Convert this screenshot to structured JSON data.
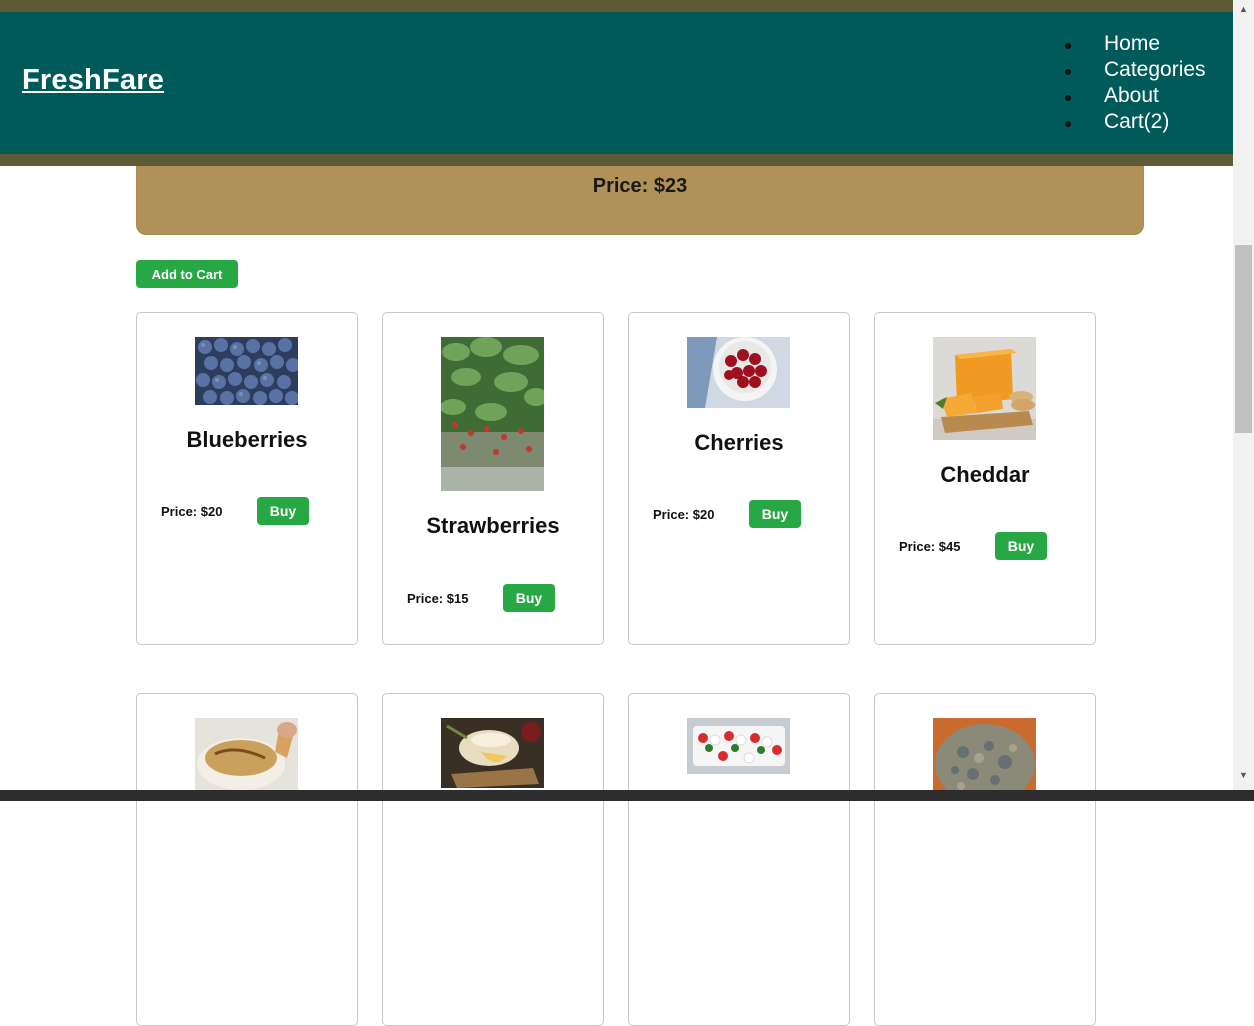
{
  "navbar": {
    "brand": "FreshFare",
    "links": [
      "Home",
      "Categories",
      "About",
      "Cart(2)"
    ]
  },
  "product_detail": {
    "price": "Price: $23",
    "add_to_cart": "Add to Cart"
  },
  "products": [
    {
      "name": "Blueberries",
      "price": "Price: $20",
      "buy": "Buy",
      "image": "blueberries-photo"
    },
    {
      "name": "Strawberries",
      "price": "Price: $15",
      "buy": "Buy",
      "image": "strawberries-photo"
    },
    {
      "name": "Cherries",
      "price": "Price: $20",
      "buy": "Buy",
      "image": "cherries-photo"
    },
    {
      "name": "Cheddar",
      "price": "Price: $45",
      "buy": "Buy",
      "image": "cheddar-photo"
    },
    {
      "name": "",
      "price": "",
      "buy": "",
      "image": "cheese-dip-photo"
    },
    {
      "name": "",
      "price": "",
      "buy": "",
      "image": "baked-brie-photo"
    },
    {
      "name": "",
      "price": "",
      "buy": "",
      "image": "caprese-skewers-photo"
    },
    {
      "name": "",
      "price": "",
      "buy": "",
      "image": "blue-cheese-photo"
    }
  ],
  "colors": {
    "navbar": "#005a5a",
    "strip": "#5d5a35",
    "price_panel": "#b09158",
    "button": "#28a745"
  }
}
